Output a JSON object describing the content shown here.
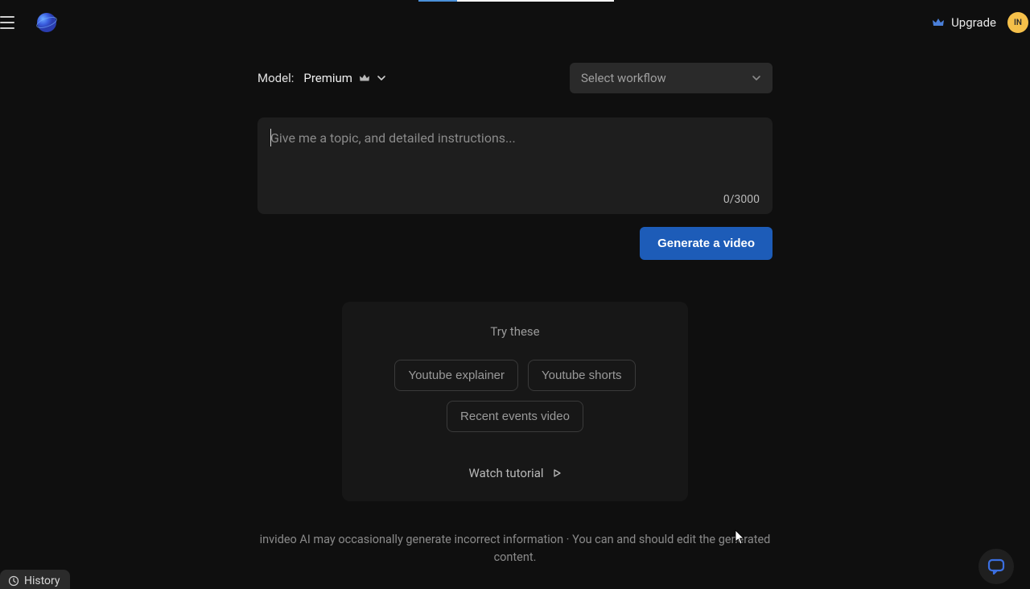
{
  "header": {
    "upgrade_label": "Upgrade",
    "avatar_initials": "IN"
  },
  "controls": {
    "model_label": "Model:",
    "model_value": "Premium",
    "workflow_placeholder": "Select workflow"
  },
  "prompt": {
    "placeholder": "Give me a topic, and detailed instructions...",
    "value": "",
    "char_count": "0/3000"
  },
  "actions": {
    "generate_label": "Generate a video"
  },
  "suggestions": {
    "heading": "Try these",
    "chips": [
      "Youtube explainer",
      "Youtube shorts",
      "Recent events video"
    ],
    "tutorial_label": "Watch tutorial"
  },
  "disclaimer": "invideo AI may occasionally generate incorrect information · You can and should edit the generated content.",
  "footer": {
    "history_label": "History"
  }
}
